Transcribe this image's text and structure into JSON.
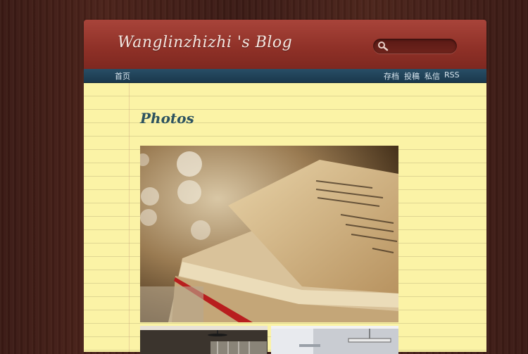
{
  "header": {
    "site_title": "Wanglinzhizhi 's Blog",
    "search_placeholder": ""
  },
  "nav": {
    "home": "首页",
    "right_links": [
      "存档",
      "投稿",
      "私信",
      "RSS"
    ]
  },
  "main": {
    "page_heading": "Photos",
    "photos": [
      {
        "icon": "open-book-photo"
      },
      {
        "icon": "ceiling-fan-room-photo"
      },
      {
        "icon": "pendant-lamp-room-photo"
      }
    ]
  },
  "colors": {
    "header": "#983a30",
    "nav": "#22455a",
    "paper": "#fbf3a6",
    "heading": "#2d5360"
  }
}
